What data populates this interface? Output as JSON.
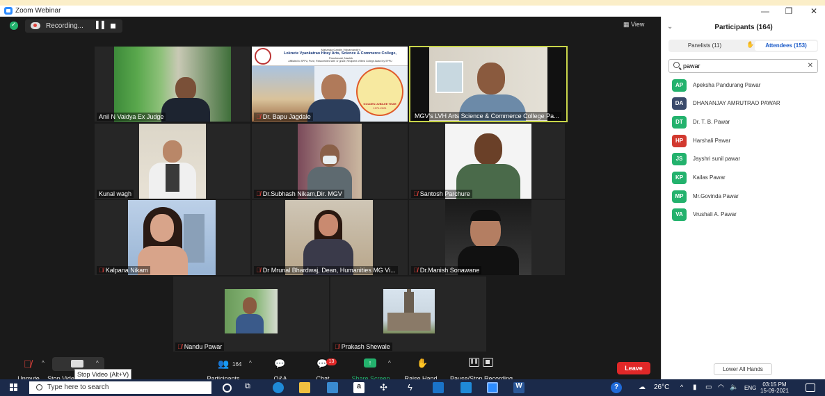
{
  "window": {
    "title": "Zoom Webinar",
    "minimize": "—",
    "restore": "❐",
    "close": "✕"
  },
  "topbar": {
    "recording_label": "Recording...",
    "view_label": "View"
  },
  "tiles": [
    {
      "name": "Anil N Vaidya Ex Judge",
      "muted": false
    },
    {
      "name": "Dr. Bapu Jagdale",
      "muted": true
    },
    {
      "name": "MGV's LVH Arts Science & Commerce College Pa...",
      "muted": false
    },
    {
      "name": "Kunal wagh",
      "muted": false
    },
    {
      "name": "Dr.Subhash Nikam,Dir. MGV",
      "muted": true
    },
    {
      "name": "Santosh Parchure",
      "muted": true
    },
    {
      "name": "Kalpana Nikam",
      "muted": true
    },
    {
      "name": "Dr Mrunal Bhardwaj, Dean, Humanities MG Vi...",
      "muted": true
    },
    {
      "name": "Dr.Manish Sonawane",
      "muted": true
    },
    {
      "name": "Nandu Pawar",
      "muted": true
    },
    {
      "name": "Prakash Shewale",
      "muted": true
    }
  ],
  "banner": {
    "line1": "Maharaja Gandhi Vidyamandir's",
    "line2": "Loknete Vyankatrao Hiray Arts, Science & Commerce College,",
    "line3": "Panchavati, Nashik",
    "line4": "Affiliated to SPPU, Pune, Reaccredited with 'A' grade, Recipient of Best College Award by SPPU",
    "jubilee": "GOLDEN JUBILEE YEAR",
    "years": "1971-2021"
  },
  "controls": {
    "unmute": "Unmute",
    "stop_video": "Stop Video",
    "participants": "Participants",
    "participants_count": "164",
    "qa": "Q&A",
    "chat": "Chat",
    "chat_badge": "13",
    "share": "Share Screen",
    "raise": "Raise Hand",
    "record": "Pause/Stop Recording",
    "leave": "Leave",
    "tooltip": "Stop Video (Alt+V)"
  },
  "panel": {
    "title": "Participants (164)",
    "tab_panelists": "Panelists (11)",
    "tab_attendees": "Attendees (153)",
    "search_value": "pawar",
    "people": [
      {
        "initials": "AP",
        "name": "Apeksha Pandurang Pawar",
        "color": "#23b26d"
      },
      {
        "initials": "DA",
        "name": "DHANANJAY AMRUTRAO PAWAR",
        "color": "#3a4a6b"
      },
      {
        "initials": "DT",
        "name": "Dr. T. B. Pawar",
        "color": "#23b26d"
      },
      {
        "initials": "HP",
        "name": "Harshali Pawar",
        "color": "#d2392f"
      },
      {
        "initials": "JS",
        "name": "Jayshri sunil pawar",
        "color": "#23b26d"
      },
      {
        "initials": "KP",
        "name": "Kailas Pawar",
        "color": "#23b26d"
      },
      {
        "initials": "MP",
        "name": "Mr.Govinda Pawar",
        "color": "#23b26d"
      },
      {
        "initials": "VA",
        "name": "Vrushali A. Pawar",
        "color": "#23b26d"
      }
    ],
    "lower_all": "Lower All Hands"
  },
  "taskbar": {
    "search_placeholder": "Type here to search",
    "temp": "26°C",
    "lang": "ENG",
    "time": "03:15 PM",
    "date": "15-09-2021"
  }
}
